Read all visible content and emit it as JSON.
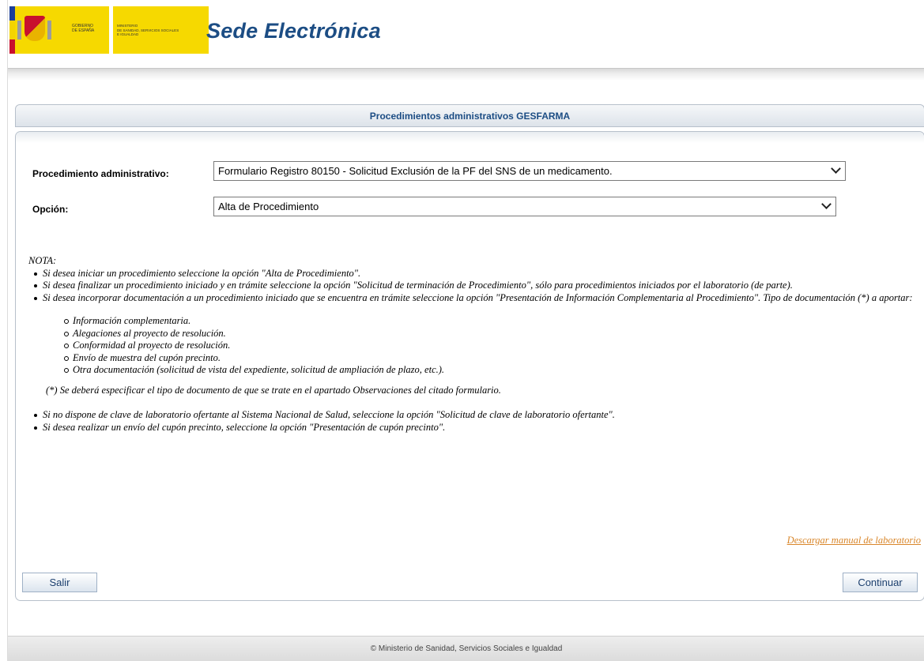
{
  "header": {
    "site_title": "Sede Electrónica",
    "logo_gobierno_text": "GOBIERNO\nDE ESPAÑA",
    "logo_ministerio_text": "MINISTERIO\nDE SANIDAD, SERVICIOS SOCIALES\nE IGUALDAD"
  },
  "section": {
    "title": "Procedimientos administrativos GESFARMA"
  },
  "form": {
    "procedimiento_label": "Procedimiento administrativo:",
    "procedimiento_value": "Formulario Registro 80150 - Solicitud Exclusión de la PF del SNS de un medicamento.",
    "opcion_label": "Opción:",
    "opcion_value": "Alta de Procedimiento"
  },
  "nota": {
    "heading": "NOTA:",
    "bullets": [
      "Si desea iniciar un procedimiento seleccione la opción \"Alta de Procedimiento\".",
      "Si desea finalizar un procedimiento iniciado y en trámite seleccione la opción \"Solicitud de terminación de Procedimiento\", sólo para procedimientos iniciados por el laboratorio (de parte).",
      "Si desea incorporar documentación a un procedimiento iniciado que se encuentra en trámite seleccione la opción \"Presentación de Información Complementaria al Procedimiento\". Tipo de documentación (*) a aportar:"
    ],
    "sub_items": [
      "Información complementaria.",
      "Alegaciones al proyecto de resolución.",
      "Conformidad al proyecto de resolución.",
      "Envío de muestra del cupón precinto.",
      "Otra documentación (solicitud de vista del expediente, solicitud de ampliación de plazo, etc.)."
    ],
    "asterisk_note": "(*) Se deberá especificar el tipo de documento de que se trate en el apartado Observaciones del citado formulario.",
    "bullets_after": [
      "Si no dispone de clave de laboratorio ofertante al Sistema Nacional de Salud, seleccione la opción \"Solicitud de clave de laboratorio ofertante\".",
      "Si desea realizar un envío del cupón precinto, seleccione la opción \"Presentación de cupón precinto\"."
    ]
  },
  "links": {
    "download_manual": "Descargar manual de laboratorio"
  },
  "buttons": {
    "salir": "Salir",
    "continuar": "Continuar"
  },
  "footer": {
    "text": "© Ministerio de Sanidad, Servicios Sociales e Igualdad"
  },
  "colors": {
    "title_blue": "#1c4d84",
    "link_orange": "#d9862a",
    "logo_yellow": "#f6d900"
  }
}
